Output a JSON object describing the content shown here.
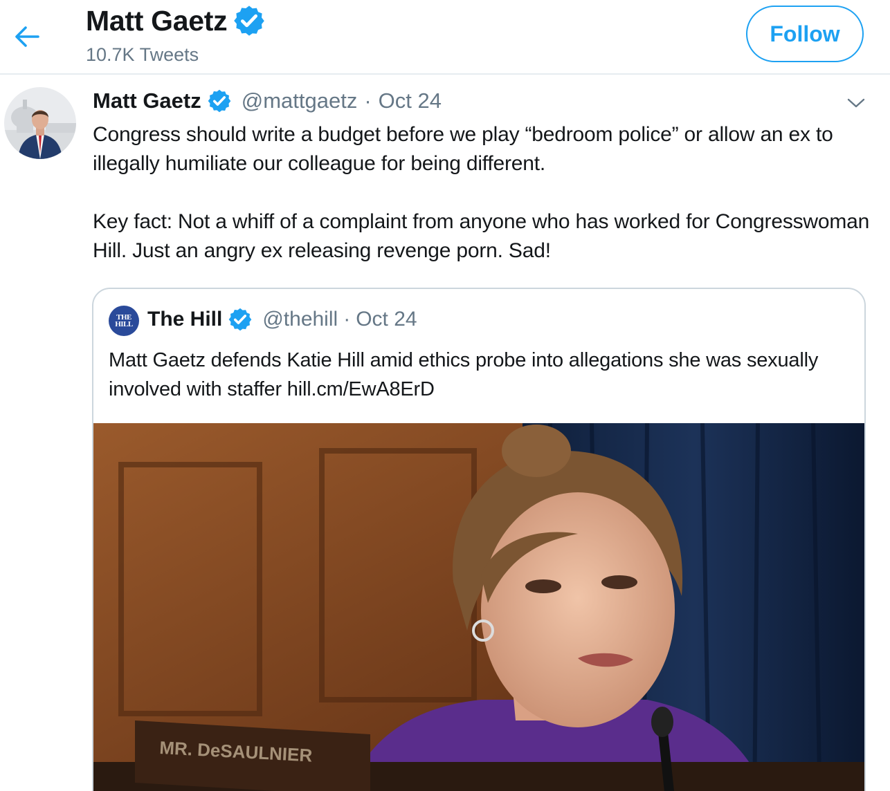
{
  "header": {
    "name": "Matt Gaetz",
    "tweet_count": "10.7K Tweets",
    "follow_label": "Follow"
  },
  "tweet": {
    "author_name": "Matt Gaetz",
    "handle": "@mattgaetz",
    "separator": "·",
    "date": "Oct 24",
    "paragraphs": [
      "Congress should write a budget before we play “bedroom police” or allow an ex to illegally humiliate our colleague for being different.",
      "Key fact: Not a whiff of a complaint from anyone who has worked for Congresswoman Hill. Just an angry ex releasing revenge porn. Sad!"
    ]
  },
  "quote": {
    "avatar_top": "THE",
    "avatar_bottom": "HILL",
    "author_name": "The Hill",
    "handle": "@thehill",
    "separator": "·",
    "date": "Oct 24",
    "text": "Matt Gaetz defends Katie Hill amid ethics probe into allegations she was sexually involved with staffer hill.cm/EwA8ErD",
    "nameplate_text": "MR. DeSAULNIER"
  },
  "colors": {
    "accent": "#1da1f2",
    "secondary_text": "#657786",
    "border": "#ccd6dd"
  },
  "icons": {
    "back": "arrow-left-icon",
    "verified": "verified-badge-icon",
    "caret": "chevron-down-icon"
  }
}
